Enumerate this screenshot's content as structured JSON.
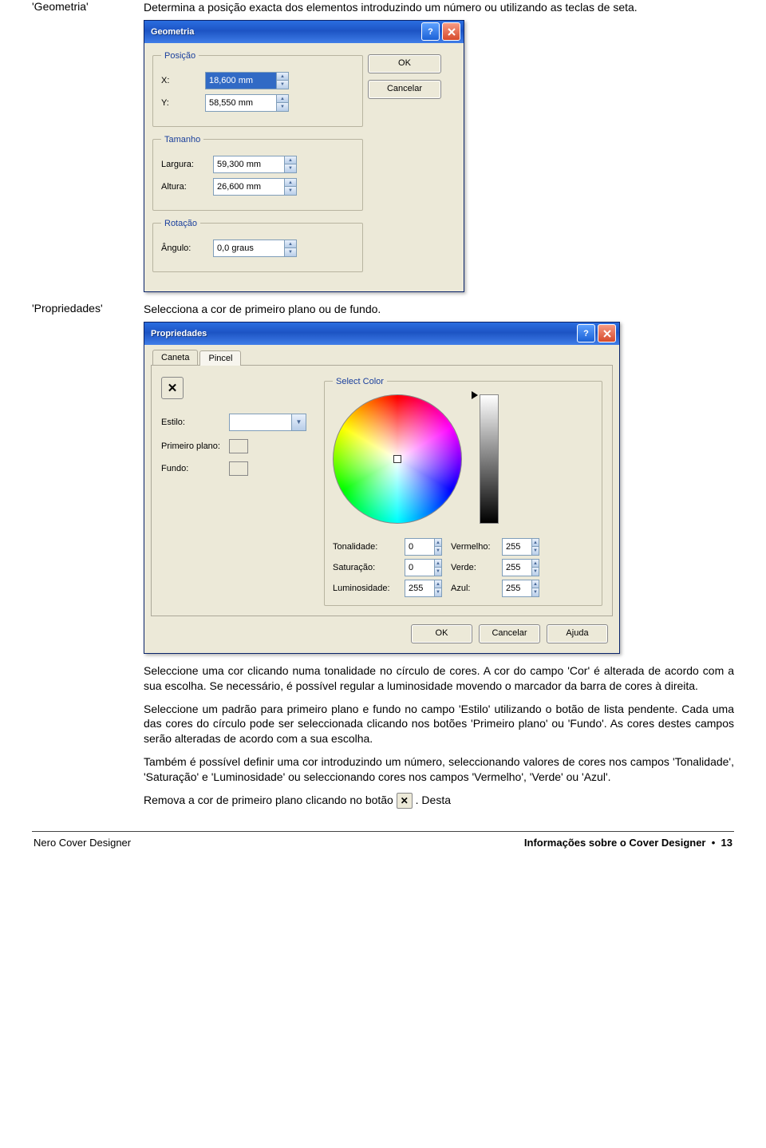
{
  "row1": {
    "label": "'Geometria'",
    "desc": "Determina a posição exacta dos elementos introduzindo um número ou utilizando as teclas de seta."
  },
  "row2": {
    "label": "'Propriedades'",
    "desc": "Selecciona a cor de primeiro plano ou de fundo."
  },
  "geom": {
    "title": "Geometria",
    "groups": {
      "pos": {
        "legend": "Posição",
        "x_label": "X:",
        "x_value": "18,600 mm",
        "y_label": "Y:",
        "y_value": "58,550 mm"
      },
      "size": {
        "legend": "Tamanho",
        "w_label": "Largura:",
        "w_value": "59,300 mm",
        "h_label": "Altura:",
        "h_value": "26,600 mm"
      },
      "rot": {
        "legend": "Rotação",
        "a_label": "Ângulo:",
        "a_value": "0,0 graus"
      }
    },
    "ok": "OK",
    "cancel": "Cancelar"
  },
  "prop": {
    "title": "Propriedades",
    "tabs": {
      "caneta": "Caneta",
      "pincel": "Pincel"
    },
    "left": {
      "estilo": "Estilo:",
      "primeiro": "Primeiro plano:",
      "fundo": "Fundo:"
    },
    "color": {
      "legend": "Select Color",
      "ton": "Tonalidade:",
      "ton_v": "0",
      "sat": "Saturação:",
      "sat_v": "0",
      "lum": "Luminosidade:",
      "lum_v": "255",
      "r": "Vermelho:",
      "r_v": "255",
      "g": "Verde:",
      "g_v": "255",
      "b": "Azul:",
      "b_v": "255"
    },
    "footer": {
      "ok": "OK",
      "cancel": "Cancelar",
      "help": "Ajuda"
    }
  },
  "p1": "Seleccione uma cor clicando numa tonalidade no círculo de cores. A cor do campo 'Cor' é alterada de acordo com a sua escolha. Se necessário, é possível regular a luminosidade movendo o marcador da barra de cores à direita.",
  "p2": "Seleccione um padrão para primeiro plano e fundo no campo 'Estilo' utilizando o botão de lista pendente. Cada uma das cores do círculo pode ser seleccionada clicando nos botões 'Primeiro plano' ou 'Fundo'. As cores destes campos serão alteradas de acordo com a sua escolha.",
  "p3": "Também é possível definir uma cor introduzindo um número, seleccionando valores de cores nos campos 'Tonalidade', 'Saturação' e 'Luminosidade' ou seleccionando cores nos campos 'Vermelho', 'Verde' ou 'Azul'.",
  "p4_a": "Remova a cor de primeiro plano clicando no botão ",
  "p4_b": ". Desta",
  "footer": {
    "left": "Nero Cover Designer",
    "right_text": "Informações sobre o Cover Designer",
    "bullet": "•",
    "page": "13"
  }
}
